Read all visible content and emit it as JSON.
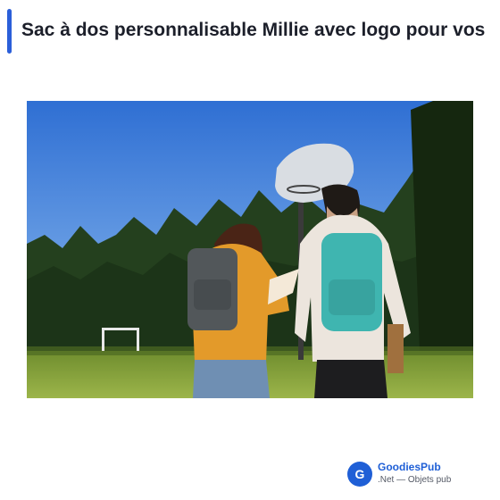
{
  "header": {
    "title": "Sac à dos personnalisable Millie avec logo pour vos"
  },
  "image": {
    "alt": "Sac à dos personnalisable Millie avec logo pour vos"
  },
  "brand": {
    "logo_letter": "G",
    "name": "GoodiesPub",
    "tagline": ".Net — Objets pub"
  },
  "colors": {
    "accent": "#2b5fd9",
    "brand": "#1f5fd6",
    "title_text": "#1c1f2a"
  }
}
